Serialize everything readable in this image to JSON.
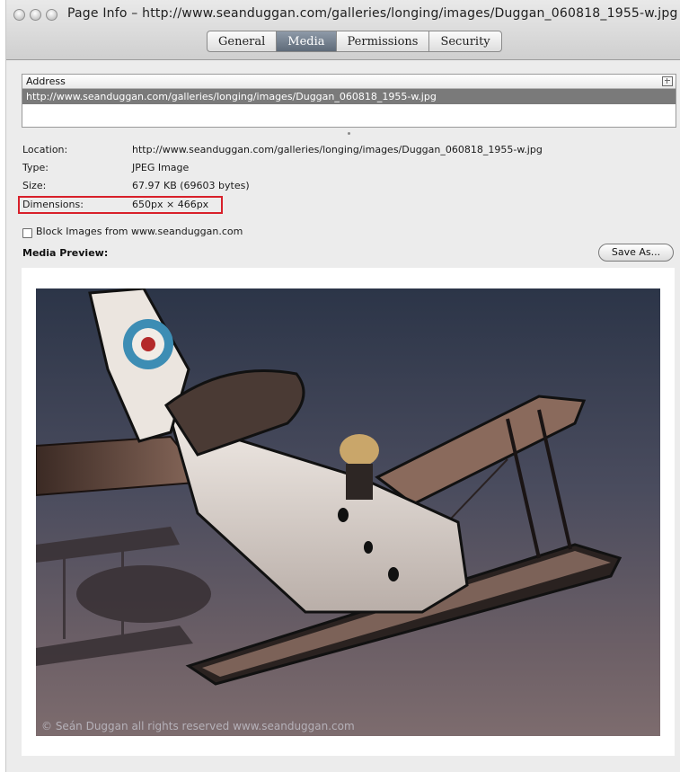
{
  "window": {
    "title": "Page Info – http://www.seanduggan.com/galleries/longing/images/Duggan_060818_1955-w.jpg"
  },
  "tabs": [
    {
      "label": "General",
      "active": false
    },
    {
      "label": "Media",
      "active": true
    },
    {
      "label": "Permissions",
      "active": false
    },
    {
      "label": "Security",
      "active": false
    }
  ],
  "address_list": {
    "header": "Address",
    "rows": [
      "http://www.seanduggan.com/galleries/longing/images/Duggan_060818_1955-w.jpg"
    ]
  },
  "info": {
    "location_label": "Location:",
    "location_value": "http://www.seanduggan.com/galleries/longing/images/Duggan_060818_1955-w.jpg",
    "type_label": "Type:",
    "type_value": "JPEG Image",
    "size_label": "Size:",
    "size_value": "67.97 KB (69603 bytes)",
    "dimensions_label": "Dimensions:",
    "dimensions_value": "650px × 466px"
  },
  "block_images": {
    "label": "Block Images from www.seanduggan.com",
    "checked": false
  },
  "preview": {
    "label": "Media Preview:",
    "save_button": "Save As...",
    "watermark": "© Seán Duggan  all rights reserved  www.seanduggan.com"
  },
  "colors": {
    "highlight_box": "#d8202a",
    "selected_row": "#7a7a7a",
    "active_tab": "#6f7b89"
  }
}
